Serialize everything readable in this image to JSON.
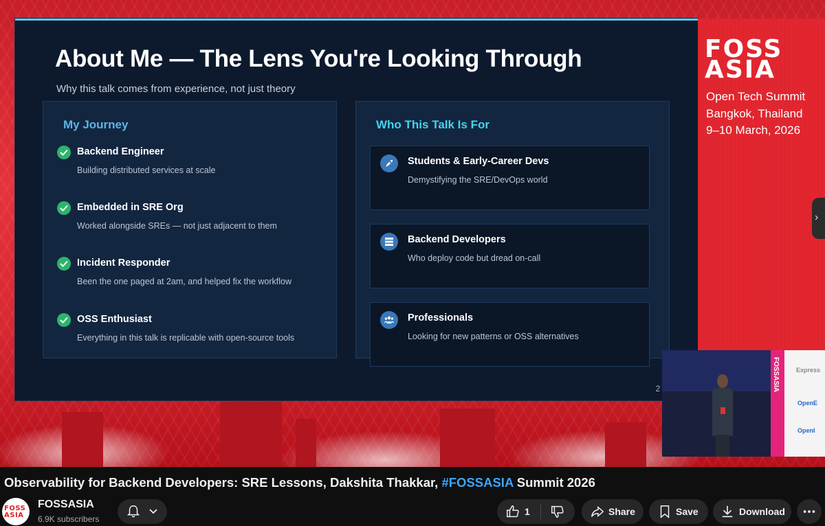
{
  "slide": {
    "title": "About Me — The Lens You're Looking Through",
    "subtitle": "Why this talk comes from experience, not just theory",
    "left_heading": "My Journey",
    "right_heading": "Who This Talk Is For",
    "journey": [
      {
        "title": "Backend Engineer",
        "desc": "Building distributed services at scale"
      },
      {
        "title": "Embedded in SRE Org",
        "desc": "Worked alongside SREs — not just adjacent to them"
      },
      {
        "title": "Incident Responder",
        "desc": "Been the one paged at 2am, and helped fix the workflow"
      },
      {
        "title": "OSS Enthusiast",
        "desc": "Everything in this talk is replicable with open-source tools"
      }
    ],
    "audience": [
      {
        "icon": "rocket-icon",
        "title": "Students & Early-Career Devs",
        "desc": "Demystifying the SRE/DevOps world"
      },
      {
        "icon": "server-icon",
        "title": "Backend Developers",
        "desc": "Who deploy code but dread on-call"
      },
      {
        "icon": "people-icon",
        "title": "Professionals",
        "desc": "Looking for new patterns or OSS alternatives"
      }
    ],
    "page_number": "2 /"
  },
  "brand": {
    "logo_line1": "FOSS",
    "logo_line2": "ASIA",
    "event_name": "Open Tech Summit",
    "location": "Bangkok, Thailand",
    "dates": "9–10 March, 2026"
  },
  "camera": {
    "banner_text": "FOSSASIA",
    "sponsor1": "Express",
    "sponsor2": "OpenE",
    "sponsor3": "OpenI"
  },
  "video": {
    "title_main": "Observability for Backend Developers: SRE Lessons, Dakshita Thakkar, ",
    "title_hashtag": "#FOSSASIA",
    "title_end": " Summit 2026"
  },
  "channel": {
    "name": "FOSSASIA",
    "subscribers": "6.9K subscribers",
    "avatar_line1": "FOSS",
    "avatar_line2": "ASIA"
  },
  "actions": {
    "like_count": "1",
    "share_label": "Share",
    "save_label": "Save",
    "download_label": "Download"
  },
  "colors": {
    "accent_link": "#3ea6ff",
    "brand_red": "#e2262f",
    "slide_bg": "#0d1a2e",
    "check_green": "#2db46c"
  }
}
